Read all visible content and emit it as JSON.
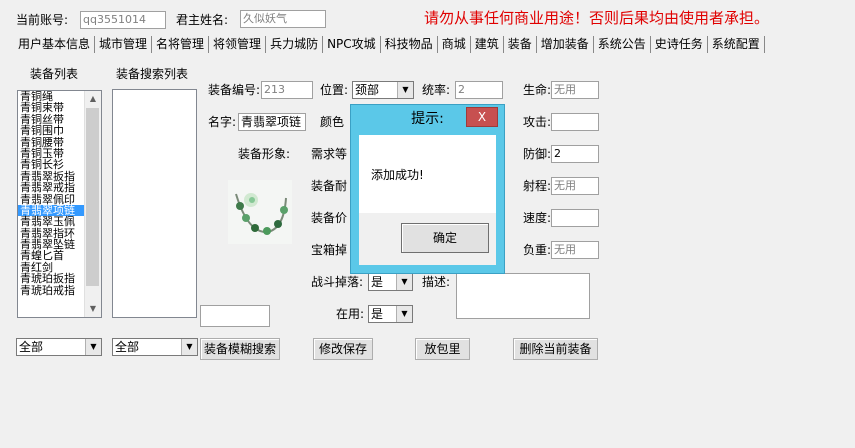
{
  "header": {
    "account_label": "当前账号:",
    "account_value": "qq3551014",
    "lord_label": "君主姓名:",
    "lord_value": "久似妖气",
    "warning": "请勿从事任何商业用途！否则后果均由使用者承担。"
  },
  "tabs": [
    "用户基本信息",
    "城市管理",
    "名将管理",
    "将领管理",
    "兵力城防",
    "NPC攻城",
    "科技物品",
    "商城",
    "建筑",
    "装备",
    "增加装备",
    "系统公告",
    "史诗任务",
    "系统配置"
  ],
  "active_tab": "装备",
  "equipment_list": {
    "title": "装备列表",
    "items": [
      "青铜绳",
      "青铜束带",
      "青铜丝带",
      "青铜围巾",
      "青铜腰带",
      "青铜玉带",
      "青铜长衫",
      "青翡翠扳指",
      "青翡翠戒指",
      "青翡翠佩印",
      "青翡翠项链",
      "青翡翠玉佩",
      "青翡翠指环",
      "青翡翠坠链",
      "青蝗匕首",
      "青红剑",
      "青琥珀扳指",
      "青琥珀戒指"
    ],
    "selected": "青翡翠项链"
  },
  "search_list": {
    "title": "装备搜索列表",
    "items": []
  },
  "form": {
    "equip_id_label": "装备编号:",
    "equip_id_value": "213",
    "position_label": "位置:",
    "position_value": "颈部",
    "command_label": "统率:",
    "command_value": "2",
    "hp_label": "生命:",
    "hp_value": "无用",
    "name_label": "名字:",
    "name_value": "青翡翠项链",
    "color_label": "颜色",
    "attack_label": "攻击:",
    "attack_value": "",
    "image_label": "装备形象:",
    "level_label": "需求等",
    "defense_label": "防御:",
    "defense_value": "2",
    "durability_label": "装备耐",
    "range_label": "射程:",
    "range_value": "无用",
    "price_label": "装备价",
    "speed_label": "速度:",
    "speed_value": "",
    "chest_label": "宝箱掉",
    "load_label": "负重:",
    "load_value": "无用",
    "battle_drop_label": "战斗掉落:",
    "battle_drop_value": "是",
    "desc_label": "描述:",
    "desc_value": "",
    "in_use_label": "在用:",
    "in_use_value": "是",
    "bottom_input_value": ""
  },
  "filters": {
    "filter1": "全部",
    "filter2": "全部"
  },
  "buttons": {
    "fuzzy_search": "装备模糊搜索",
    "save": "修改保存",
    "to_bag": "放包里",
    "delete": "删除当前装备"
  },
  "dialog": {
    "title": "提示:",
    "close": "X",
    "message": "添加成功!",
    "ok": "确定"
  },
  "colors": {
    "warning": "#e00000",
    "selected": "#3399ff",
    "dialog_frame": "#5bc8e8",
    "close_button": "#c75050"
  }
}
